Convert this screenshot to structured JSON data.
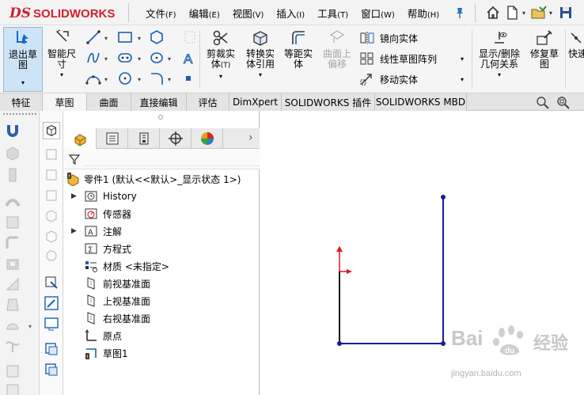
{
  "app": {
    "logo_ds": "DS",
    "logo_text": "SOLIDWORKS",
    "brand_color": "#d0202e"
  },
  "menu": {
    "items": [
      {
        "label": "文件",
        "accel": "(F)"
      },
      {
        "label": "编辑",
        "accel": "(E)"
      },
      {
        "label": "视图",
        "accel": "(V)"
      },
      {
        "label": "插入",
        "accel": "(I)"
      },
      {
        "label": "工具",
        "accel": "(T)"
      },
      {
        "label": "窗口",
        "accel": "(W)"
      },
      {
        "label": "帮助",
        "accel": "(H)"
      }
    ]
  },
  "ribbon": {
    "exit_sketch": "退出草图",
    "smart_dim": "智能尺寸",
    "trim": "剪裁实体",
    "trim_accel": "(T)",
    "convert": "转换实体引用",
    "offset": "等距实体",
    "surface_offset": "曲面上偏移",
    "mirror": "镜向实体",
    "linear_pattern": "线性草图阵列",
    "move": "移动实体",
    "display_relations": "显示/删除几何关系",
    "repair": "修复草图",
    "quick": "快速"
  },
  "tabs": [
    "特征",
    "草图",
    "曲面",
    "直接编辑",
    "评估",
    "DimXpert",
    "SOLIDWORKS 插件",
    "SOLIDWORKS MBD"
  ],
  "active_tab": "草图",
  "tree": {
    "root": "零件1 (默认<<默认>_显示状态 1>)",
    "items": [
      {
        "label": "History",
        "icon": "history-icon",
        "expandable": true
      },
      {
        "label": "传感器",
        "icon": "sensor-icon",
        "expandable": false
      },
      {
        "label": "注解",
        "icon": "annotation-icon",
        "expandable": true
      },
      {
        "label": "方程式",
        "icon": "equation-icon",
        "expandable": false
      },
      {
        "label": "材质 <未指定>",
        "icon": "material-icon",
        "expandable": false
      },
      {
        "label": "前视基准面",
        "icon": "plane-icon",
        "expandable": false
      },
      {
        "label": "上视基准面",
        "icon": "plane-icon",
        "expandable": false
      },
      {
        "label": "右视基准面",
        "icon": "plane-icon",
        "expandable": false
      },
      {
        "label": "原点",
        "icon": "origin-icon",
        "expandable": false
      },
      {
        "label": "草图1",
        "icon": "sketch-icon",
        "expandable": false
      }
    ]
  },
  "watermark": {
    "brand": "Bai",
    "brand2": "经验",
    "url": "jingyan.baidu.com"
  },
  "colors": {
    "sketch_line": "#1a1aa0",
    "sketch_point": "#1a1aa0",
    "axis_red": "#e0141e",
    "selected_blue": "#cde4f7"
  }
}
